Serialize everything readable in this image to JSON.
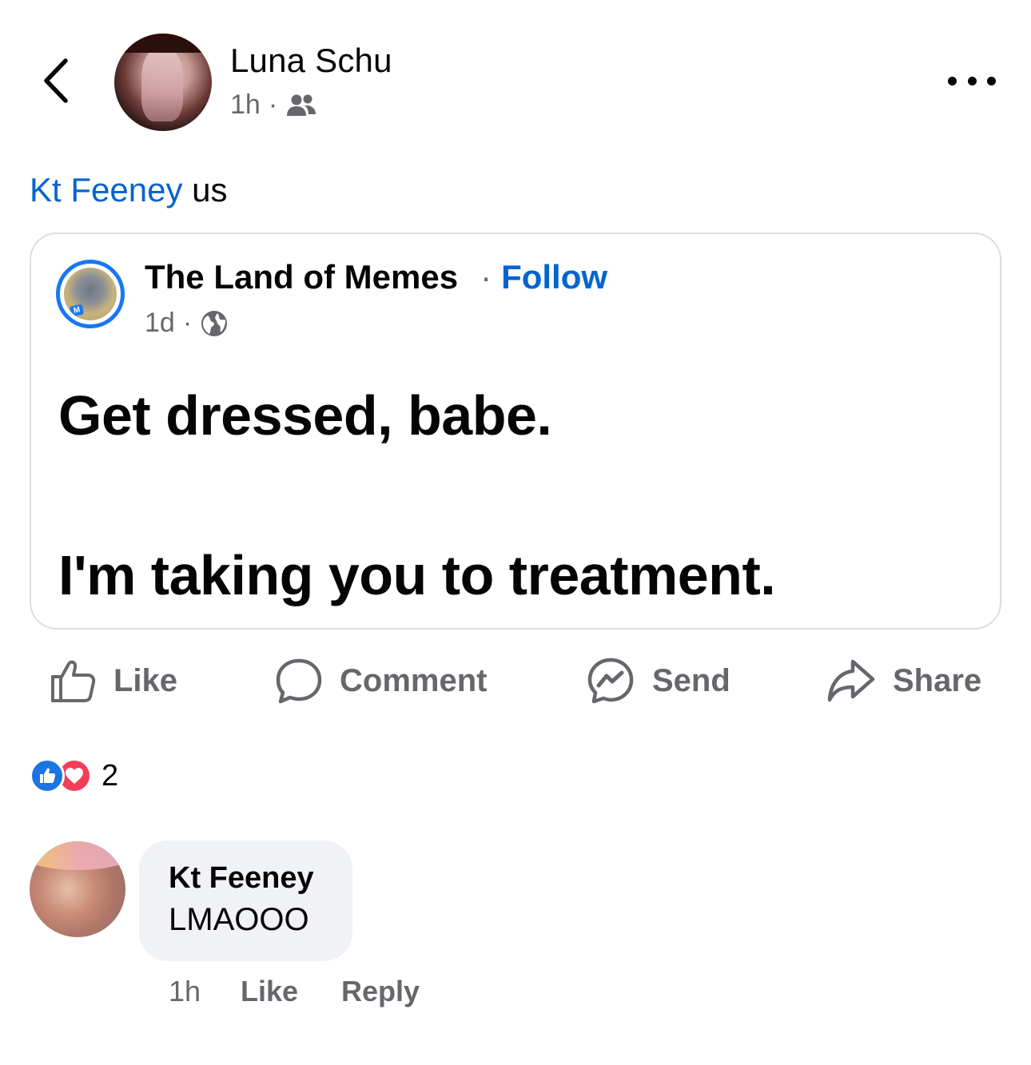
{
  "header": {
    "author_name": "Luna Schu",
    "time": "1h",
    "audience_icon": "friends-icon"
  },
  "caption": {
    "mention": "Kt Feeney",
    "text": " us"
  },
  "shared_post": {
    "page_name": "The Land of Memes",
    "separator": "·",
    "follow_label": "Follow",
    "time": "1d",
    "audience_icon": "globe-icon",
    "text": "Get dressed, babe.\n\nI'm taking you to treatment."
  },
  "actions": {
    "like": "Like",
    "comment": "Comment",
    "send": "Send",
    "share": "Share"
  },
  "reactions": {
    "count": "2",
    "types": [
      "like",
      "love"
    ],
    "colors": {
      "like": "#1b74e4",
      "love": "#f33e58"
    }
  },
  "comment": {
    "author": "Kt Feeney",
    "text": "LMAOOO",
    "time": "1h",
    "like_label": "Like",
    "reply_label": "Reply"
  },
  "colors": {
    "link": "#0064d1",
    "secondary_text": "#65676b",
    "bubble": "#f0f2f5"
  }
}
